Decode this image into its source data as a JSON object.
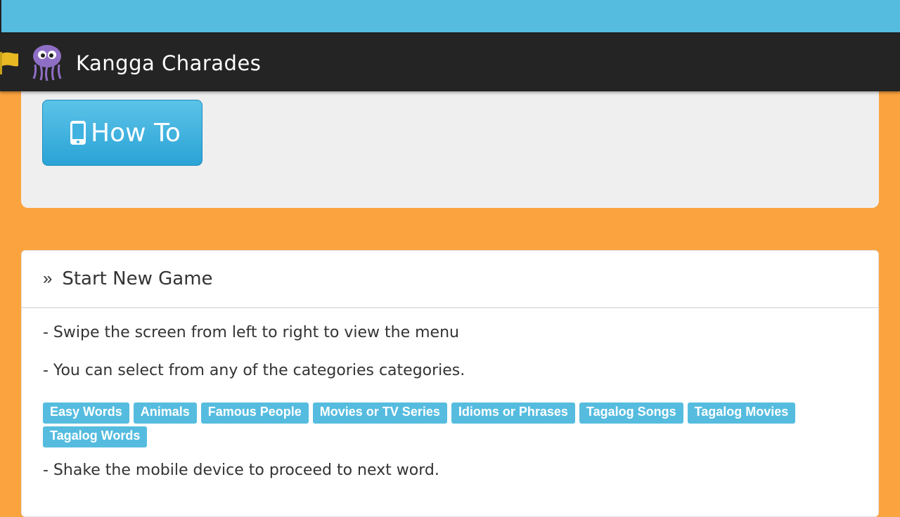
{
  "app_bar": {
    "title": "Kangga Charades"
  },
  "top_panel": {
    "howto_label": "How To"
  },
  "card": {
    "title": "Start New Game",
    "raquo": "»",
    "lines": [
      "- Swipe the screen from left to right to view the menu",
      "- You can select from any of the categories categories.",
      "- Shake the mobile device to proceed to next word."
    ],
    "categories": [
      "Easy Words",
      "Animals",
      "Famous People",
      "Movies or TV Series",
      "Idioms or Phrases",
      "Tagalog Songs",
      "Tagalog Movies",
      "Tagalog Words"
    ]
  },
  "colors": {
    "status_bar": "#55bcdf",
    "app_bar": "#242424",
    "background": "#fba33e",
    "accent": "#55bcdf"
  }
}
